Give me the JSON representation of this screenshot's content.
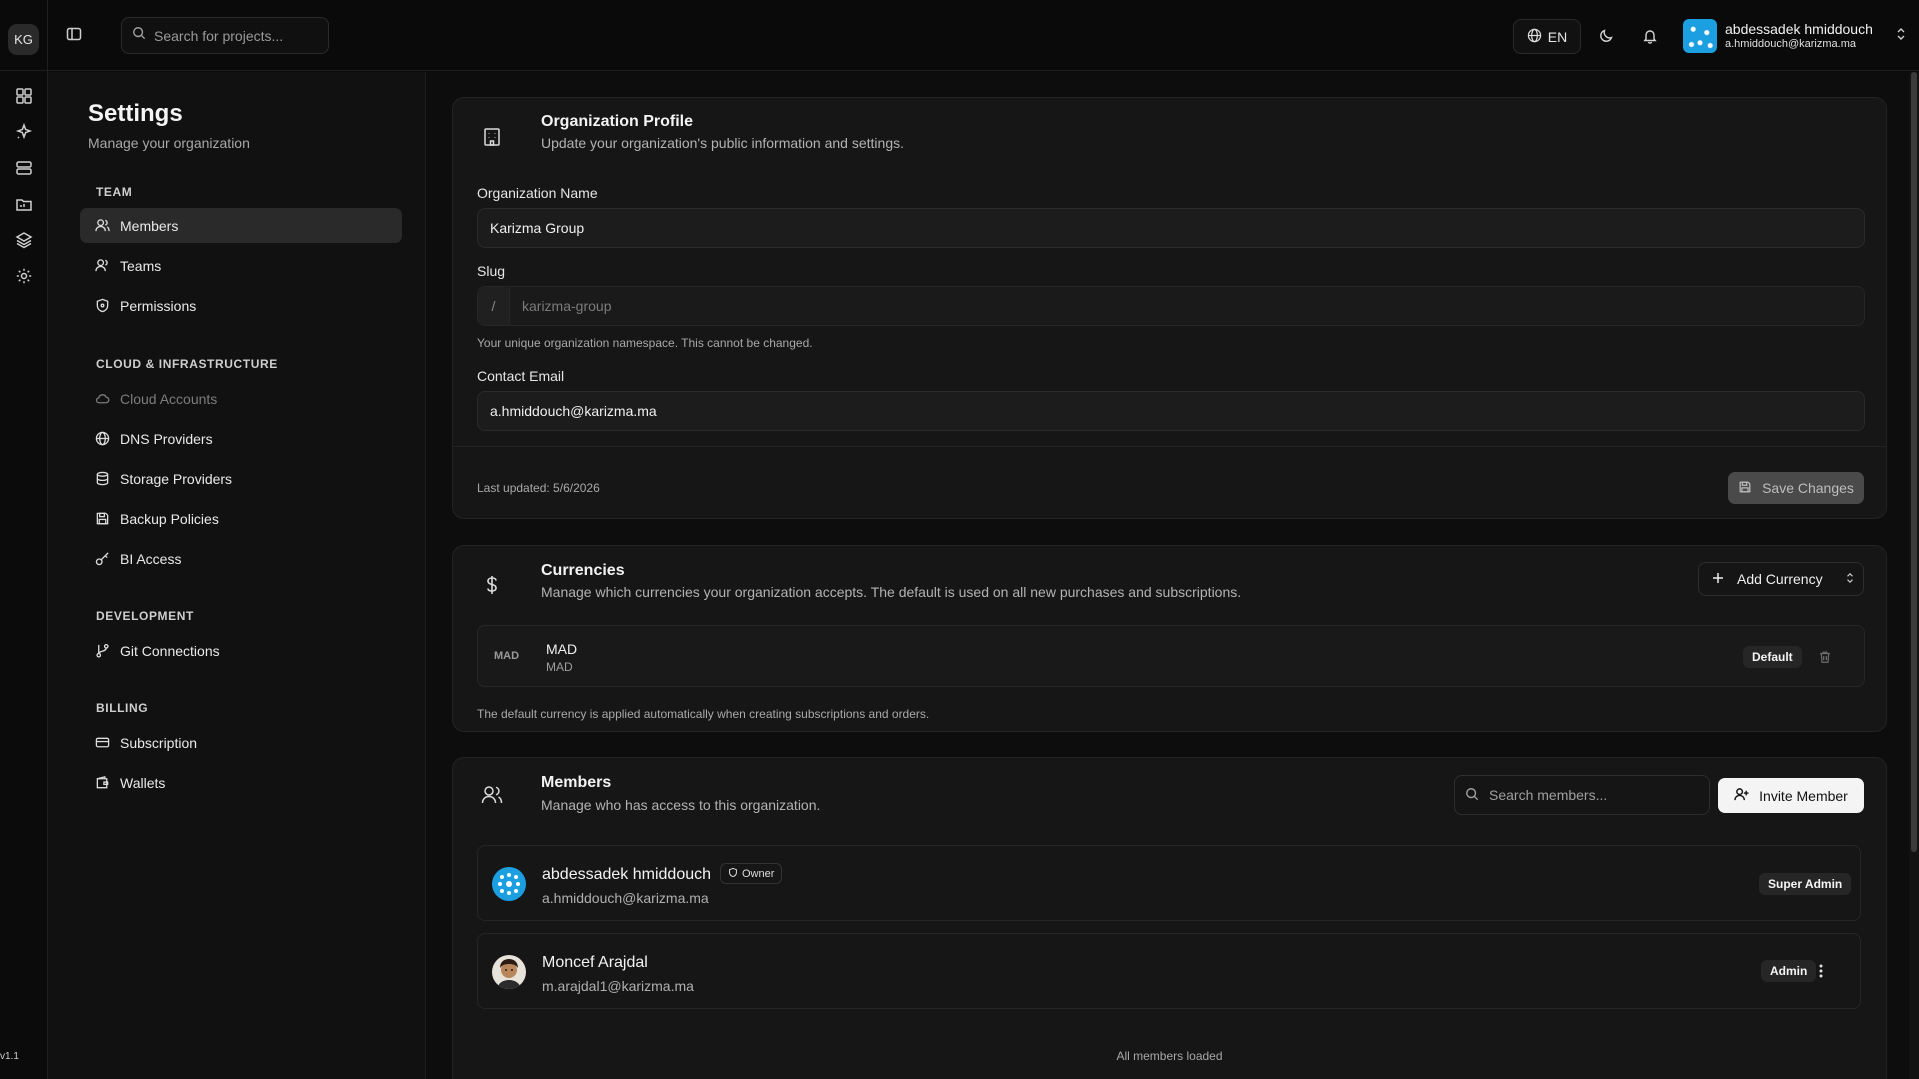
{
  "app": {
    "logo": "KG",
    "version": "v1.1"
  },
  "topbar": {
    "search_placeholder": "Search for projects...",
    "language": "EN",
    "user_name": "abdessadek hmiddouch",
    "user_email": "a.hmiddouch@karizma.ma"
  },
  "rail": {
    "icons": [
      "dashboard-icon",
      "sparkle-icon",
      "server-icon",
      "folder-icon",
      "layers-icon",
      "gear-icon"
    ]
  },
  "settings": {
    "title": "Settings",
    "subtitle": "Manage your organization",
    "sections": {
      "team": "TEAM",
      "cloud": "CLOUD & INFRASTRUCTURE",
      "development": "DEVELOPMENT",
      "billing": "BILLING"
    },
    "items": {
      "members": "Members",
      "teams": "Teams",
      "permissions": "Permissions",
      "cloud_accounts": "Cloud Accounts",
      "dns_providers": "DNS Providers",
      "storage_providers": "Storage Providers",
      "backup_policies": "Backup Policies",
      "bi_access": "BI Access",
      "git_connections": "Git Connections",
      "subscription": "Subscription",
      "wallets": "Wallets"
    }
  },
  "org_profile": {
    "title": "Organization Profile",
    "description": "Update your organization's public information and settings.",
    "name_label": "Organization Name",
    "name_value": "Karizma Group",
    "slug_label": "Slug",
    "slug_prefix": "/",
    "slug_value": "karizma-group",
    "slug_hint": "Your unique organization namespace. This cannot be changed.",
    "email_label": "Contact Email",
    "email_value": "a.hmiddouch@karizma.ma",
    "last_updated": "Last updated: 5/6/2026",
    "save_label": "Save Changes"
  },
  "currencies": {
    "title": "Currencies",
    "description": "Manage which currencies your organization accepts. The default is used on all new purchases and subscriptions.",
    "add_label": "Add Currency",
    "rows": [
      {
        "code": "MAD",
        "name": "MAD",
        "sub": "MAD",
        "badge": "Default"
      }
    ],
    "note": "The default currency is applied automatically when creating subscriptions and orders."
  },
  "members": {
    "title": "Members",
    "description": "Manage who has access to this organization.",
    "search_placeholder": "Search members...",
    "invite_label": "Invite Member",
    "list": [
      {
        "name": "abdessadek hmiddouch",
        "email": "a.hmiddouch@karizma.ma",
        "tag": "Owner",
        "role": "Super Admin"
      },
      {
        "name": "Moncef Arajdal",
        "email": "m.arajdal1@karizma.ma",
        "role": "Admin"
      }
    ],
    "footer": "All members loaded"
  },
  "colors": {
    "background": "#0b0b0b",
    "panel": "#161616",
    "accent_button": "#f4f4f4",
    "avatar_blue": "#1b9fe0"
  }
}
